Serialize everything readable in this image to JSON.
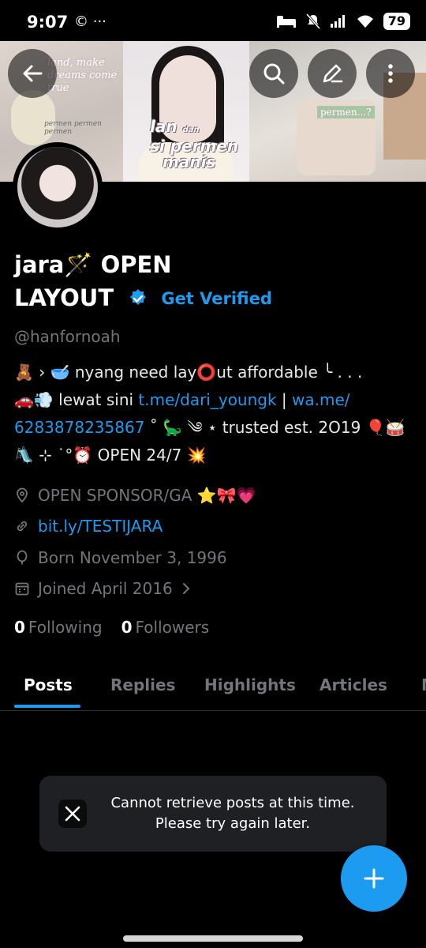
{
  "status_bar": {
    "time": "9:07",
    "left_icons": "© ···",
    "battery": "79"
  },
  "banner": {
    "tile1_text": "land, make dreams come true",
    "tile1_caption": "permen permen permen",
    "overlay_line1": "lan",
    "overlay_small": "dan",
    "overlay_line2": "si permen",
    "overlay_line3": "manis",
    "tile3_text": "permen...?"
  },
  "profile": {
    "name_line1": "jara🪄 OPEN",
    "name_line2": "LAYOUT",
    "get_verified": "Get Verified",
    "handle": "@hanfornoah",
    "bio": {
      "line1": "🧸 › 🥣 nyang need lay⭕ut affordable ╰ . . .",
      "line2_prefix": "🚗💨 lewat sini ",
      "link1": "t.me/dari_youngk",
      "separator": " | ",
      "link2_part1": "wa.me/",
      "link2_part2": "6283878235867",
      "line3_suffix": " ˚ 🦕 ༄ ⋆ trusted est. 2O19 🎈🥁",
      "line4": "🛝 ⊹ ˙°⏰ OPEN 24/7 💥"
    },
    "location": "OPEN SPONSOR/GA ⭐🎀💗",
    "website": "bit.ly/TESTIJARA",
    "born": "Born November 3, 1996",
    "joined": "Joined April 2016",
    "following_count": "0",
    "following_label": "Following",
    "followers_count": "0",
    "followers_label": "Followers"
  },
  "tabs": [
    {
      "label": "Posts"
    },
    {
      "label": "Replies"
    },
    {
      "label": "Highlights"
    },
    {
      "label": "Articles"
    },
    {
      "label": "M"
    }
  ],
  "toast": {
    "line1": "Cannot retrieve posts at this time.",
    "line2": "Please try again later."
  },
  "colors": {
    "accent": "#1d9bf0",
    "background": "#000000",
    "muted_text": "#71767b"
  },
  "icons": {
    "back": "arrow-left-icon",
    "search": "search-icon",
    "edit": "pencil-icon",
    "more": "more-vertical-icon",
    "location": "location-pin-icon",
    "link": "link-icon",
    "born": "balloon-icon",
    "joined": "calendar-icon",
    "compose": "plus-icon"
  }
}
